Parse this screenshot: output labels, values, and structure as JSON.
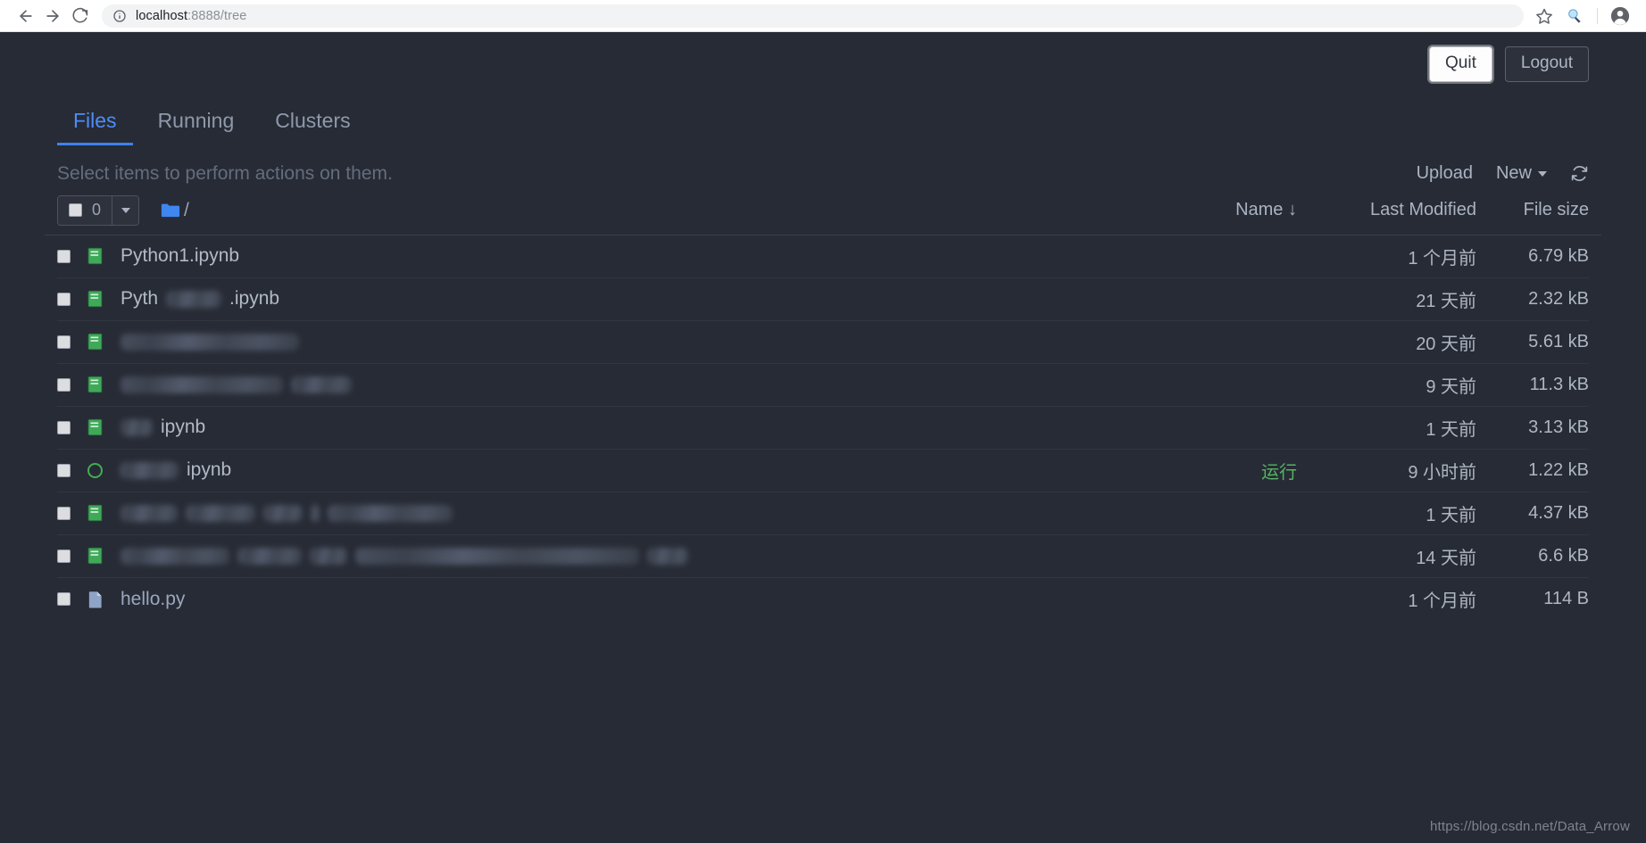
{
  "browser": {
    "url_host": "localhost",
    "url_path": ":8888/tree",
    "back_icon": "back-arrow-icon",
    "forward_icon": "forward-arrow-icon",
    "reload_icon": "reload-icon",
    "info_icon": "site-info-icon",
    "bookmark_icon": "star-icon",
    "extension_icon": "extension-magnifier-icon",
    "profile_icon": "profile-avatar-icon"
  },
  "header": {
    "quit_label": "Quit",
    "logout_label": "Logout"
  },
  "tabs": [
    {
      "label": "Files",
      "active": true
    },
    {
      "label": "Running",
      "active": false
    },
    {
      "label": "Clusters",
      "active": false
    }
  ],
  "toolbar": {
    "hint": "Select items to perform actions on them.",
    "upload_label": "Upload",
    "new_label": "New",
    "refresh_icon": "refresh-icon"
  },
  "list_header": {
    "selected_count": "0",
    "breadcrumb_root": "/",
    "folder_icon": "folder-icon",
    "col_name": "Name",
    "sort_icon": "sort-descending-arrow-icon",
    "col_last_modified": "Last Modified",
    "col_file_size": "File size"
  },
  "colors": {
    "page_bg": "#272b35",
    "accent_blue": "#4d8df7",
    "running_green": "#54b463",
    "notebook_green": "#3fa95a",
    "text_primary": "#b2bac7",
    "text_muted": "#646d7e",
    "row_divider": "#32363f"
  },
  "files": [
    {
      "icon": "notebook-icon",
      "name": "Python1.ipynb",
      "redacted": false,
      "status": "",
      "modified": "1 个月前",
      "size": "6.79 kB"
    },
    {
      "icon": "notebook-icon",
      "name": "Pyth████.ipynb",
      "redacted": true,
      "prefix": "Pyth",
      "suffix": ".ipynb",
      "blocks": [
        62
      ],
      "status": "",
      "modified": "21 天前",
      "size": "2.32 kB"
    },
    {
      "icon": "notebook-icon",
      "name": "",
      "redacted": true,
      "prefix": "",
      "suffix": "",
      "blocks": [
        200
      ],
      "status": "",
      "modified": "20 天前",
      "size": "5.61 kB"
    },
    {
      "icon": "notebook-icon",
      "name": "",
      "redacted": true,
      "prefix": "",
      "suffix": "",
      "blocks": [
        182,
        68
      ],
      "status": "",
      "modified": "9 天前",
      "size": "11.3 kB"
    },
    {
      "icon": "notebook-icon",
      "name": "ipynb",
      "redacted": true,
      "prefix": "",
      "suffix": "ipynb",
      "blocks": [
        36
      ],
      "status": "",
      "modified": "1 天前",
      "size": "3.13 kB"
    },
    {
      "icon": "running-notebook-icon",
      "name": "ipynb",
      "redacted": true,
      "prefix": "",
      "suffix": "ipynb",
      "blocks": [
        66
      ],
      "status": "运行",
      "modified": "9 小时前",
      "size": "1.22 kB"
    },
    {
      "icon": "notebook-icon",
      "name": "",
      "redacted": true,
      "prefix": "",
      "suffix": "",
      "blocks": [
        64,
        78,
        44,
        10,
        140
      ],
      "status": "",
      "modified": "1 天前",
      "size": "4.37 kB"
    },
    {
      "icon": "notebook-icon",
      "name": "",
      "redacted": true,
      "prefix": "",
      "suffix": "",
      "blocks": [
        122,
        72,
        42,
        318,
        46
      ],
      "status": "",
      "modified": "14 天前",
      "size": "6.6 kB"
    },
    {
      "icon": "python-file-icon",
      "name": "hello.py",
      "redacted": false,
      "status": "",
      "modified": "1 个月前",
      "size": "114 B"
    }
  ],
  "watermark": "https://blog.csdn.net/Data_Arrow"
}
